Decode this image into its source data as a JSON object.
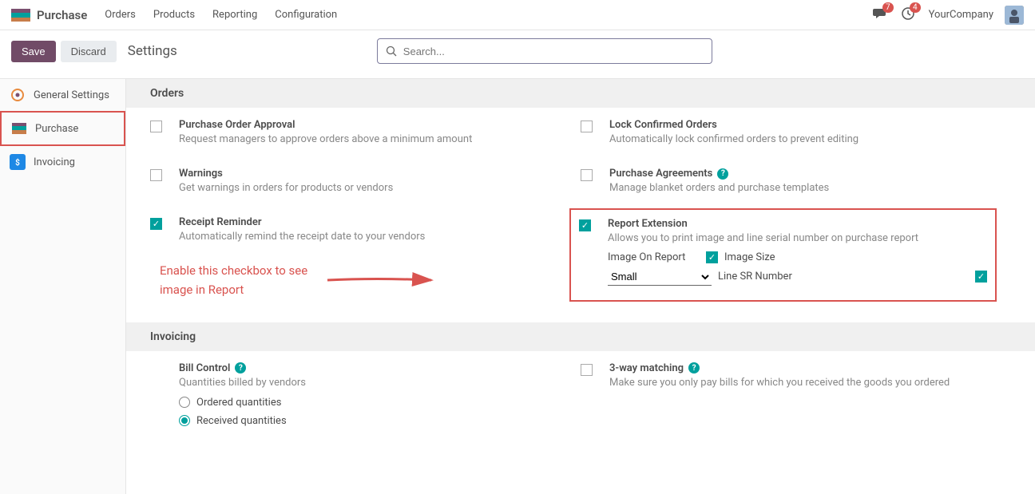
{
  "topbar": {
    "app_title": "Purchase",
    "nav": [
      "Orders",
      "Products",
      "Reporting",
      "Configuration"
    ],
    "chat_badge": "7",
    "activity_badge": "4",
    "company": "YourCompany"
  },
  "controlbar": {
    "save": "Save",
    "discard": "Discard",
    "title": "Settings",
    "search_placeholder": "Search..."
  },
  "sidebar": {
    "items": [
      {
        "label": "General Settings"
      },
      {
        "label": "Purchase"
      },
      {
        "label": "Invoicing"
      }
    ]
  },
  "sections": {
    "orders": {
      "title": "Orders",
      "po_approval": {
        "title": "Purchase Order Approval",
        "desc": "Request managers to approve orders above a minimum amount",
        "checked": false
      },
      "lock_confirmed": {
        "title": "Lock Confirmed Orders",
        "desc": "Automatically lock confirmed orders to prevent editing",
        "checked": false
      },
      "warnings": {
        "title": "Warnings",
        "desc": "Get warnings in orders for products or vendors",
        "checked": false
      },
      "agreements": {
        "title": "Purchase Agreements",
        "desc": "Manage blanket orders and purchase templates",
        "checked": false
      },
      "receipt_reminder": {
        "title": "Receipt Reminder",
        "desc": "Automatically remind the receipt date to your vendors",
        "checked": true
      },
      "report_extension": {
        "title": "Report Extension",
        "desc": "Allows you to print image and line serial number on purchase report",
        "checked": true,
        "image_on_report_label": "Image On Report",
        "image_size_label": "Image Size",
        "image_size_checked": true,
        "size_value": "Small",
        "line_sr_label": "Line SR Number",
        "line_sr_checked": true
      },
      "annotation": "Enable  this checkbox to see image in Report"
    },
    "invoicing": {
      "title": "Invoicing",
      "bill_control": {
        "title": "Bill Control",
        "desc": "Quantities billed by vendors",
        "ordered_label": "Ordered quantities",
        "received_label": "Received quantities",
        "selected": "received"
      },
      "three_way": {
        "title": "3-way matching",
        "desc": "Make sure you only pay bills for which you received the goods you ordered",
        "checked": false
      }
    }
  }
}
